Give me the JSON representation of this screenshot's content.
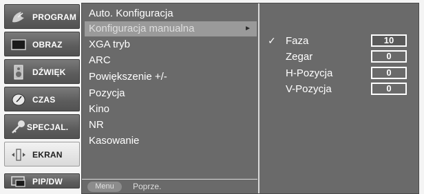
{
  "categories": [
    {
      "label": "PROGRAM",
      "icon": "satellite-dish-icon"
    },
    {
      "label": "OBRAZ",
      "icon": "screen-icon"
    },
    {
      "label": "DŹWIĘK",
      "icon": "speaker-icon"
    },
    {
      "label": "CZAS",
      "icon": "clock-icon"
    },
    {
      "label": "SPECJAL.",
      "icon": "key-icon"
    },
    {
      "label": "EKRAN",
      "icon": "screen-adjust-icon",
      "active": true
    },
    {
      "label": "PIP/DW",
      "icon": "pip-icon"
    }
  ],
  "menu": {
    "items": [
      "Auto. Konfiguracja",
      "Konfiguracja manualna",
      "XGA tryb",
      "ARC",
      "Powiększenie +/-",
      "Pozycja",
      "Kino",
      "NR",
      "Kasowanie"
    ],
    "selected_index": 1,
    "arrow": "►"
  },
  "submenu": {
    "rows": [
      {
        "label": "Faza",
        "value": "10",
        "checked": true
      },
      {
        "label": "Zegar",
        "value": "0"
      },
      {
        "label": "H-Pozycja",
        "value": "0"
      },
      {
        "label": "V-Pozycja",
        "value": "0"
      }
    ],
    "check_glyph": "✓"
  },
  "footer": {
    "menu_key": "Menu",
    "back_label": "Poprze."
  },
  "colors": {
    "panel_bg": "#6a6a6a",
    "highlight": "#9a9a9a",
    "tab_bg": "#5c5c5c",
    "active_tab_bg": "#e6e6e6"
  }
}
